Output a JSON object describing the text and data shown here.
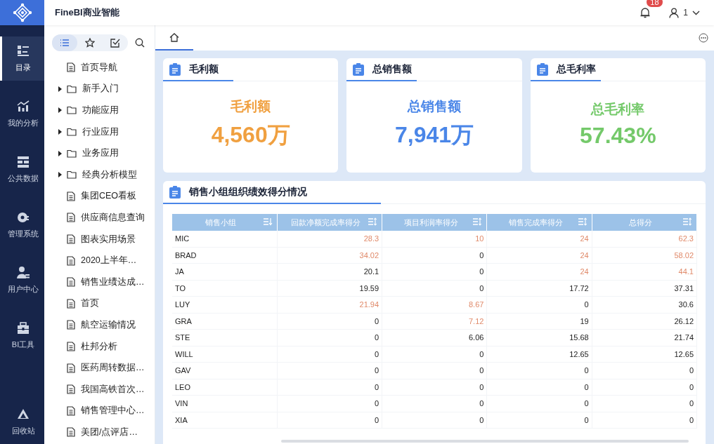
{
  "app": {
    "title": "FineBI商业智能"
  },
  "header": {
    "notification_count": "18",
    "user": "1"
  },
  "nav": [
    {
      "label": "目录",
      "selected": true
    },
    {
      "label": "我的分析",
      "selected": false
    },
    {
      "label": "公共数据",
      "selected": false
    },
    {
      "label": "管理系统",
      "selected": false
    },
    {
      "label": "用户中心",
      "selected": false
    },
    {
      "label": "BI工具",
      "selected": false
    },
    {
      "label": "回收站",
      "selected": false
    }
  ],
  "tree_toolbar": [
    {
      "selected": true
    },
    {
      "selected": false
    },
    {
      "selected": false
    }
  ],
  "tree": [
    {
      "kind": "doc",
      "label": "首页导航"
    },
    {
      "kind": "folder",
      "label": "新手入门",
      "expanded": false
    },
    {
      "kind": "folder",
      "label": "功能应用",
      "expanded": false
    },
    {
      "kind": "folder",
      "label": "行业应用",
      "expanded": false
    },
    {
      "kind": "folder",
      "label": "业务应用",
      "expanded": false
    },
    {
      "kind": "folder",
      "label": "经典分析模型",
      "expanded": false
    },
    {
      "kind": "doc",
      "label": "集团CEO看板"
    },
    {
      "kind": "doc",
      "label": "供应商信息查询"
    },
    {
      "kind": "doc",
      "label": "图表实用场景"
    },
    {
      "kind": "doc",
      "label": "2020上半年…"
    },
    {
      "kind": "doc",
      "label": "销售业绩达成…"
    },
    {
      "kind": "doc",
      "label": "首页"
    },
    {
      "kind": "doc",
      "label": "航空运输情况"
    },
    {
      "kind": "doc",
      "label": "杜邦分析"
    },
    {
      "kind": "doc",
      "label": "医药周转数据…"
    },
    {
      "kind": "doc",
      "label": "我国高铁首次…"
    },
    {
      "kind": "doc",
      "label": "销售管理中心…"
    },
    {
      "kind": "doc",
      "label": "美团/点评店…"
    }
  ],
  "kpis": [
    {
      "title": "毛利额",
      "label": "毛利额",
      "value": "4,560万",
      "color": "#f0a040"
    },
    {
      "title": "总销售额",
      "label": "总销售额",
      "value": "7,941万",
      "color": "#4a86e8"
    },
    {
      "title": "总毛利率",
      "label": "总毛利率",
      "value": "57.43%",
      "color": "#74c96a"
    }
  ],
  "table": {
    "title": "销售小组组织绩效得分情况",
    "columns": [
      {
        "label": "销售小组",
        "sorted": true
      },
      {
        "label": "回款净额完成率得分",
        "sorted": false
      },
      {
        "label": "项目利润率得分",
        "sorted": false
      },
      {
        "label": "销售完成率得分",
        "sorted": false
      },
      {
        "label": "总得分",
        "sorted": false
      }
    ],
    "rows": [
      [
        {
          "text": "MIC",
          "highlight": false
        },
        {
          "text": "28.3",
          "highlight": true
        },
        {
          "text": "10",
          "highlight": true
        },
        {
          "text": "24",
          "highlight": true
        },
        {
          "text": "62.3",
          "highlight": true
        }
      ],
      [
        {
          "text": "BRAD",
          "highlight": false
        },
        {
          "text": "34.02",
          "highlight": true
        },
        {
          "text": "0",
          "highlight": false
        },
        {
          "text": "24",
          "highlight": true
        },
        {
          "text": "58.02",
          "highlight": true
        }
      ],
      [
        {
          "text": "JA",
          "highlight": false
        },
        {
          "text": "20.1",
          "highlight": false
        },
        {
          "text": "0",
          "highlight": false
        },
        {
          "text": "24",
          "highlight": true
        },
        {
          "text": "44.1",
          "highlight": true
        }
      ],
      [
        {
          "text": "TO",
          "highlight": false
        },
        {
          "text": "19.59",
          "highlight": false
        },
        {
          "text": "0",
          "highlight": false
        },
        {
          "text": "17.72",
          "highlight": false
        },
        {
          "text": "37.31",
          "highlight": false
        }
      ],
      [
        {
          "text": "LUY",
          "highlight": false
        },
        {
          "text": "21.94",
          "highlight": true
        },
        {
          "text": "8.67",
          "highlight": true
        },
        {
          "text": "0",
          "highlight": false
        },
        {
          "text": "30.6",
          "highlight": false
        }
      ],
      [
        {
          "text": "GRA",
          "highlight": false
        },
        {
          "text": "0",
          "highlight": false
        },
        {
          "text": "7.12",
          "highlight": true
        },
        {
          "text": "19",
          "highlight": false
        },
        {
          "text": "26.12",
          "highlight": false
        }
      ],
      [
        {
          "text": "STE",
          "highlight": false
        },
        {
          "text": "0",
          "highlight": false
        },
        {
          "text": "6.06",
          "highlight": false
        },
        {
          "text": "15.68",
          "highlight": false
        },
        {
          "text": "21.74",
          "highlight": false
        }
      ],
      [
        {
          "text": "WILL",
          "highlight": false
        },
        {
          "text": "0",
          "highlight": false
        },
        {
          "text": "0",
          "highlight": false
        },
        {
          "text": "12.65",
          "highlight": false
        },
        {
          "text": "12.65",
          "highlight": false
        }
      ],
      [
        {
          "text": "GAV",
          "highlight": false
        },
        {
          "text": "0",
          "highlight": false
        },
        {
          "text": "0",
          "highlight": false
        },
        {
          "text": "0",
          "highlight": false
        },
        {
          "text": "0",
          "highlight": false
        }
      ],
      [
        {
          "text": "LEO",
          "highlight": false
        },
        {
          "text": "0",
          "highlight": false
        },
        {
          "text": "0",
          "highlight": false
        },
        {
          "text": "0",
          "highlight": false
        },
        {
          "text": "0",
          "highlight": false
        }
      ],
      [
        {
          "text": "VIN",
          "highlight": false
        },
        {
          "text": "0",
          "highlight": false
        },
        {
          "text": "0",
          "highlight": false
        },
        {
          "text": "0",
          "highlight": false
        },
        {
          "text": "0",
          "highlight": false
        }
      ],
      [
        {
          "text": "XIA",
          "highlight": false
        },
        {
          "text": "0",
          "highlight": false
        },
        {
          "text": "0",
          "highlight": false
        },
        {
          "text": "0",
          "highlight": false
        },
        {
          "text": "0",
          "highlight": false
        }
      ]
    ]
  }
}
